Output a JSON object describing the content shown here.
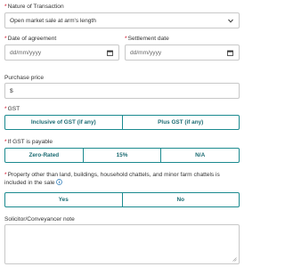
{
  "nature": {
    "label": "Nature of Transaction",
    "value": "Open market sale at arm's length"
  },
  "dates": {
    "agreement_label": "Date of agreement",
    "agreement_placeholder": "dd/mm/yyyy",
    "settlement_label": "Settlement date",
    "settlement_placeholder": "dd/mm/yyyy"
  },
  "price": {
    "label": "Purchase price",
    "prefix": "$"
  },
  "gst": {
    "label": "GST",
    "options": [
      "Inclusive of GST (if any)",
      "Plus GST (if any)"
    ]
  },
  "gst_payable": {
    "label": "If GST is payable",
    "options": [
      "Zero-Rated",
      "15%",
      "N/A"
    ]
  },
  "chattels": {
    "label": "Property other than land, buildings, household chattels, and minor farm chattels is included in the sale",
    "options": [
      "Yes",
      "No"
    ]
  },
  "note": {
    "label": "Solicitor/Conveyancer note"
  },
  "required_mark": "*",
  "colors": {
    "accent": "#1b8a8f",
    "required": "#d0021b",
    "info": "#2a7ab8"
  }
}
